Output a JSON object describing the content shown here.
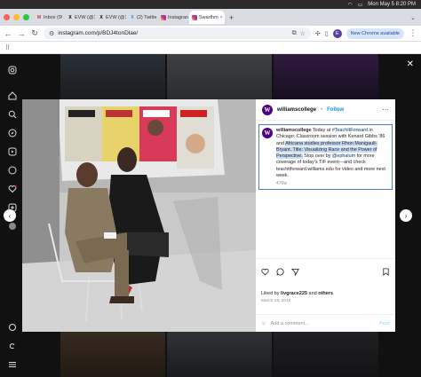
{
  "menubar": {
    "time": "Mon May 5  8:20 PM"
  },
  "tabs": [
    {
      "label": "Inbox (9!",
      "icon": "gmail-icon",
      "color": "#d93025",
      "glyph": "M"
    },
    {
      "label": "EVW (@1",
      "icon": "x-icon",
      "color": "#000000",
      "glyph": "X"
    },
    {
      "label": "EVW (@1",
      "icon": "x-icon",
      "color": "#000000",
      "glyph": "X"
    },
    {
      "label": "(2) Twitte",
      "icon": "twitter-icon",
      "color": "#1d9bf0",
      "glyph": "X"
    },
    {
      "label": "Instagran",
      "icon": "instagram-icon",
      "color": "#d6249f",
      "glyph": ""
    },
    {
      "label": "Swarthm",
      "icon": "instagram-icon",
      "color": "#d6249f",
      "glyph": "",
      "active": true
    }
  ],
  "toolbar": {
    "url": "instagram.com/p/BDJ4tonDlae/",
    "profile_initial": "E",
    "new_chrome": "New Chrome available"
  },
  "post": {
    "username": "williamscollege",
    "follow": "Follow",
    "avatar": "W",
    "caption": {
      "username": "williamscollege",
      "t1": " Today at ",
      "hashtag": "#TeachItForward",
      "t2": " in Chicago: Classroom session with Kenard Gibbs '86 and ",
      "hl1": "Africana studies professor Rhon Manigault-Bryant. Title: Visualizing Race and the Power of Perspective.",
      "t3": " Stop over by ",
      "mention": "@ephalum",
      "t4": " for more coverage of today's TIF event—and check teachitforward.williams.edu for video and more next week."
    },
    "caption_time": "476w",
    "liked_by_prefix": "Liked by ",
    "liked_by_user": "livgrace225",
    "liked_by_suffix": " and ",
    "liked_by_others": "others",
    "date": "March 19, 2016",
    "comment_placeholder": "Add a comment...",
    "post_button": "Post"
  },
  "colors": {
    "accent": "#0095f6",
    "brand": "#500082"
  }
}
